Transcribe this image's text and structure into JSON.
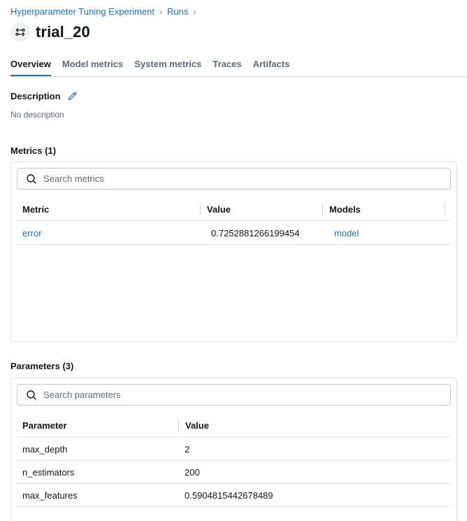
{
  "breadcrumb": {
    "experiment": "Hyperparameter Tuning Experiment",
    "runs": "Runs",
    "separator": "›"
  },
  "run": {
    "name": "trial_20"
  },
  "tabs": [
    {
      "label": "Overview",
      "active": true
    },
    {
      "label": "Model metrics",
      "active": false
    },
    {
      "label": "System metrics",
      "active": false
    },
    {
      "label": "Traces",
      "active": false
    },
    {
      "label": "Artifacts",
      "active": false
    }
  ],
  "description": {
    "label": "Description",
    "text": "No description"
  },
  "metrics": {
    "label": "Metrics (1)",
    "search_placeholder": "Search metrics",
    "columns": [
      "Metric",
      "Value",
      "Models"
    ],
    "rows": [
      {
        "metric": "error",
        "value": "0.7252881266199454",
        "model": "model"
      }
    ]
  },
  "parameters": {
    "label": "Parameters (3)",
    "search_placeholder": "Search parameters",
    "columns": [
      "Parameter",
      "Value"
    ],
    "rows": [
      {
        "parameter": "max_depth",
        "value": "2"
      },
      {
        "parameter": "n_estimators",
        "value": "200"
      },
      {
        "parameter": "max_features",
        "value": "0.5904815442678489"
      }
    ]
  },
  "colors": {
    "link": "#2272b4",
    "text": "#11171c",
    "muted": "#5f6b77",
    "border": "#e0e5ea"
  },
  "icons": {
    "run": "run-swap-icon",
    "edit": "pencil-icon",
    "search": "search-icon",
    "breadcrumb_separator": "chevron-right-icon"
  }
}
